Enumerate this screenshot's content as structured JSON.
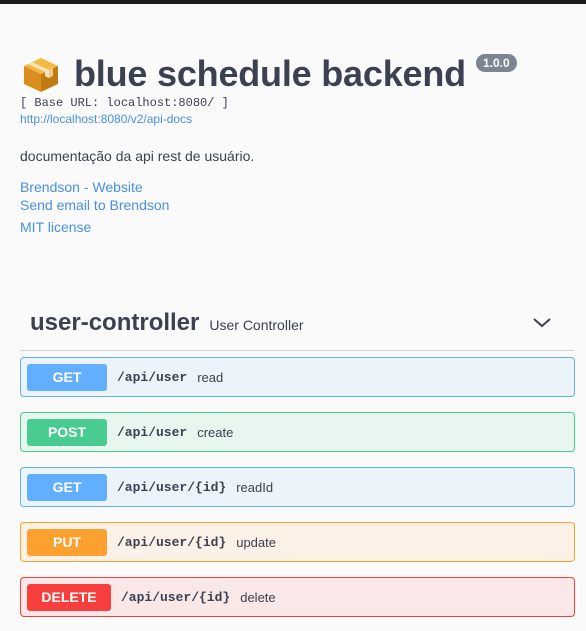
{
  "info": {
    "title": "blue schedule backend",
    "version": "1.0.0",
    "base_url": "[ Base URL: localhost:8080/ ]",
    "api_docs_link": "http://localhost:8080/v2/api-docs",
    "description": "documentação da api rest de usuário.",
    "contact_website": "Brendson - Website",
    "contact_email": "Send email to Brendson",
    "license": "MIT license",
    "title_icon": "package-box-icon"
  },
  "tag": {
    "name": "user-controller",
    "description": "User Controller",
    "toggle_icon": "chevron-down-icon"
  },
  "operations": [
    {
      "method": "GET",
      "path": "/api/user",
      "summary": "read",
      "color": "#61affe"
    },
    {
      "method": "POST",
      "path": "/api/user",
      "summary": "create",
      "color": "#49cc90"
    },
    {
      "method": "GET",
      "path": "/api/user/{id}",
      "summary": "readId",
      "color": "#61affe"
    },
    {
      "method": "PUT",
      "path": "/api/user/{id}",
      "summary": "update",
      "color": "#fca130"
    },
    {
      "method": "DELETE",
      "path": "/api/user/{id}",
      "summary": "delete",
      "color": "#f93e3e"
    }
  ]
}
